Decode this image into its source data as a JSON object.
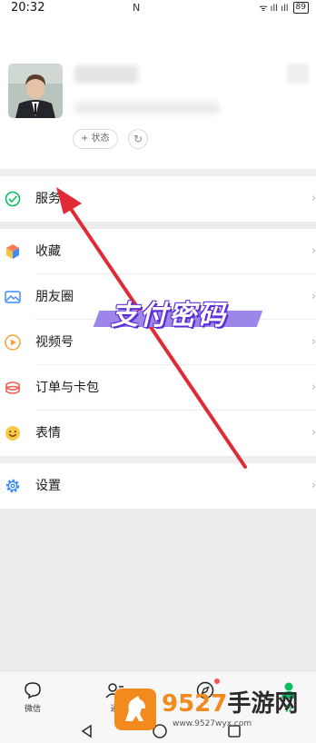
{
  "status_bar": {
    "time": "20:32",
    "nfc": "N",
    "signal": "ᯤ ıll ıll",
    "battery": "89"
  },
  "profile": {
    "status_button": "+ 状态"
  },
  "menu": {
    "service": {
      "label": "服务"
    },
    "items": [
      {
        "label": "收藏"
      },
      {
        "label": "朋友圈"
      },
      {
        "label": "视频号"
      },
      {
        "label": "订单与卡包"
      },
      {
        "label": "表情"
      }
    ],
    "settings": {
      "label": "设置"
    },
    "chevron": "›"
  },
  "overlay": {
    "text": "支付密码"
  },
  "tabs": [
    {
      "label": "微信",
      "icon": "chat-bubble-icon"
    },
    {
      "label": "通",
      "icon": "contacts-icon"
    },
    {
      "label": "",
      "icon": "compass-icon"
    },
    {
      "label": "我",
      "icon": "person-icon"
    }
  ],
  "watermark": {
    "num": "9527",
    "cn": "手游网",
    "url": "www.9527wyx.com"
  },
  "colors": {
    "accent": "#07c160",
    "arrow": "#e02b36",
    "overlay": "#5a2bd8"
  }
}
